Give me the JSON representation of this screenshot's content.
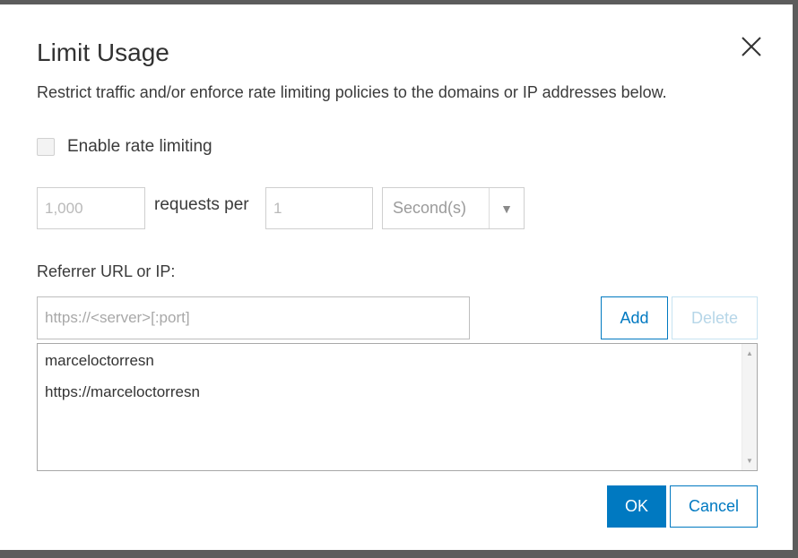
{
  "dialog": {
    "title": "Limit Usage",
    "description": "Restrict traffic and/or enforce rate limiting policies to the domains or IP addresses below."
  },
  "rate_limit": {
    "checkbox_label": "Enable rate limiting",
    "checked": false,
    "requests_placeholder": "1,000",
    "requests_per_label": "requests per",
    "interval_placeholder": "1",
    "unit_selected": "Second(s)"
  },
  "referrer": {
    "label": "Referrer URL or IP:",
    "placeholder": "https://<server>[:port]",
    "add_label": "Add",
    "delete_label": "Delete",
    "items": [
      "marceloctorresn",
      "https://marceloctorresn"
    ]
  },
  "footer": {
    "ok_label": "OK",
    "cancel_label": "Cancel"
  },
  "icons": {
    "close": "close-icon",
    "dropdown": "triangle-down-icon",
    "scroll_up": "scroll-up-icon",
    "scroll_down": "scroll-down-icon"
  },
  "colors": {
    "accent": "#0079c1",
    "overlay": "#5c5c5c"
  }
}
